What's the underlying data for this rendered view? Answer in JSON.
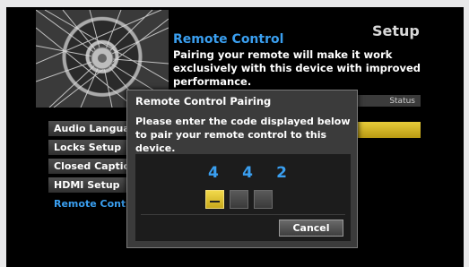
{
  "screen": {
    "title": "Setup",
    "info_title": "Remote Control",
    "info_text": "Pairing your remote will make it work exclusively with this device with improved performance.",
    "status_label": "Status"
  },
  "menu": {
    "items": [
      {
        "label": "Audio Language",
        "active": false
      },
      {
        "label": "Locks Setup",
        "active": false
      },
      {
        "label": "Closed Captions",
        "active": false
      },
      {
        "label": "HDMI Setup",
        "active": false
      },
      {
        "label": "Remote Control",
        "active": true
      }
    ]
  },
  "dialog": {
    "title": "Remote Control Pairing",
    "message": "Please enter the code displayed below to pair your remote control to this device.",
    "code_digits": [
      "4",
      "4",
      "2"
    ],
    "entered_slots": 3,
    "cancel_label": "Cancel"
  },
  "colors": {
    "accent_blue": "#3a9ff0",
    "highlight_yellow": "#e8cc3a",
    "background": "#000000"
  }
}
